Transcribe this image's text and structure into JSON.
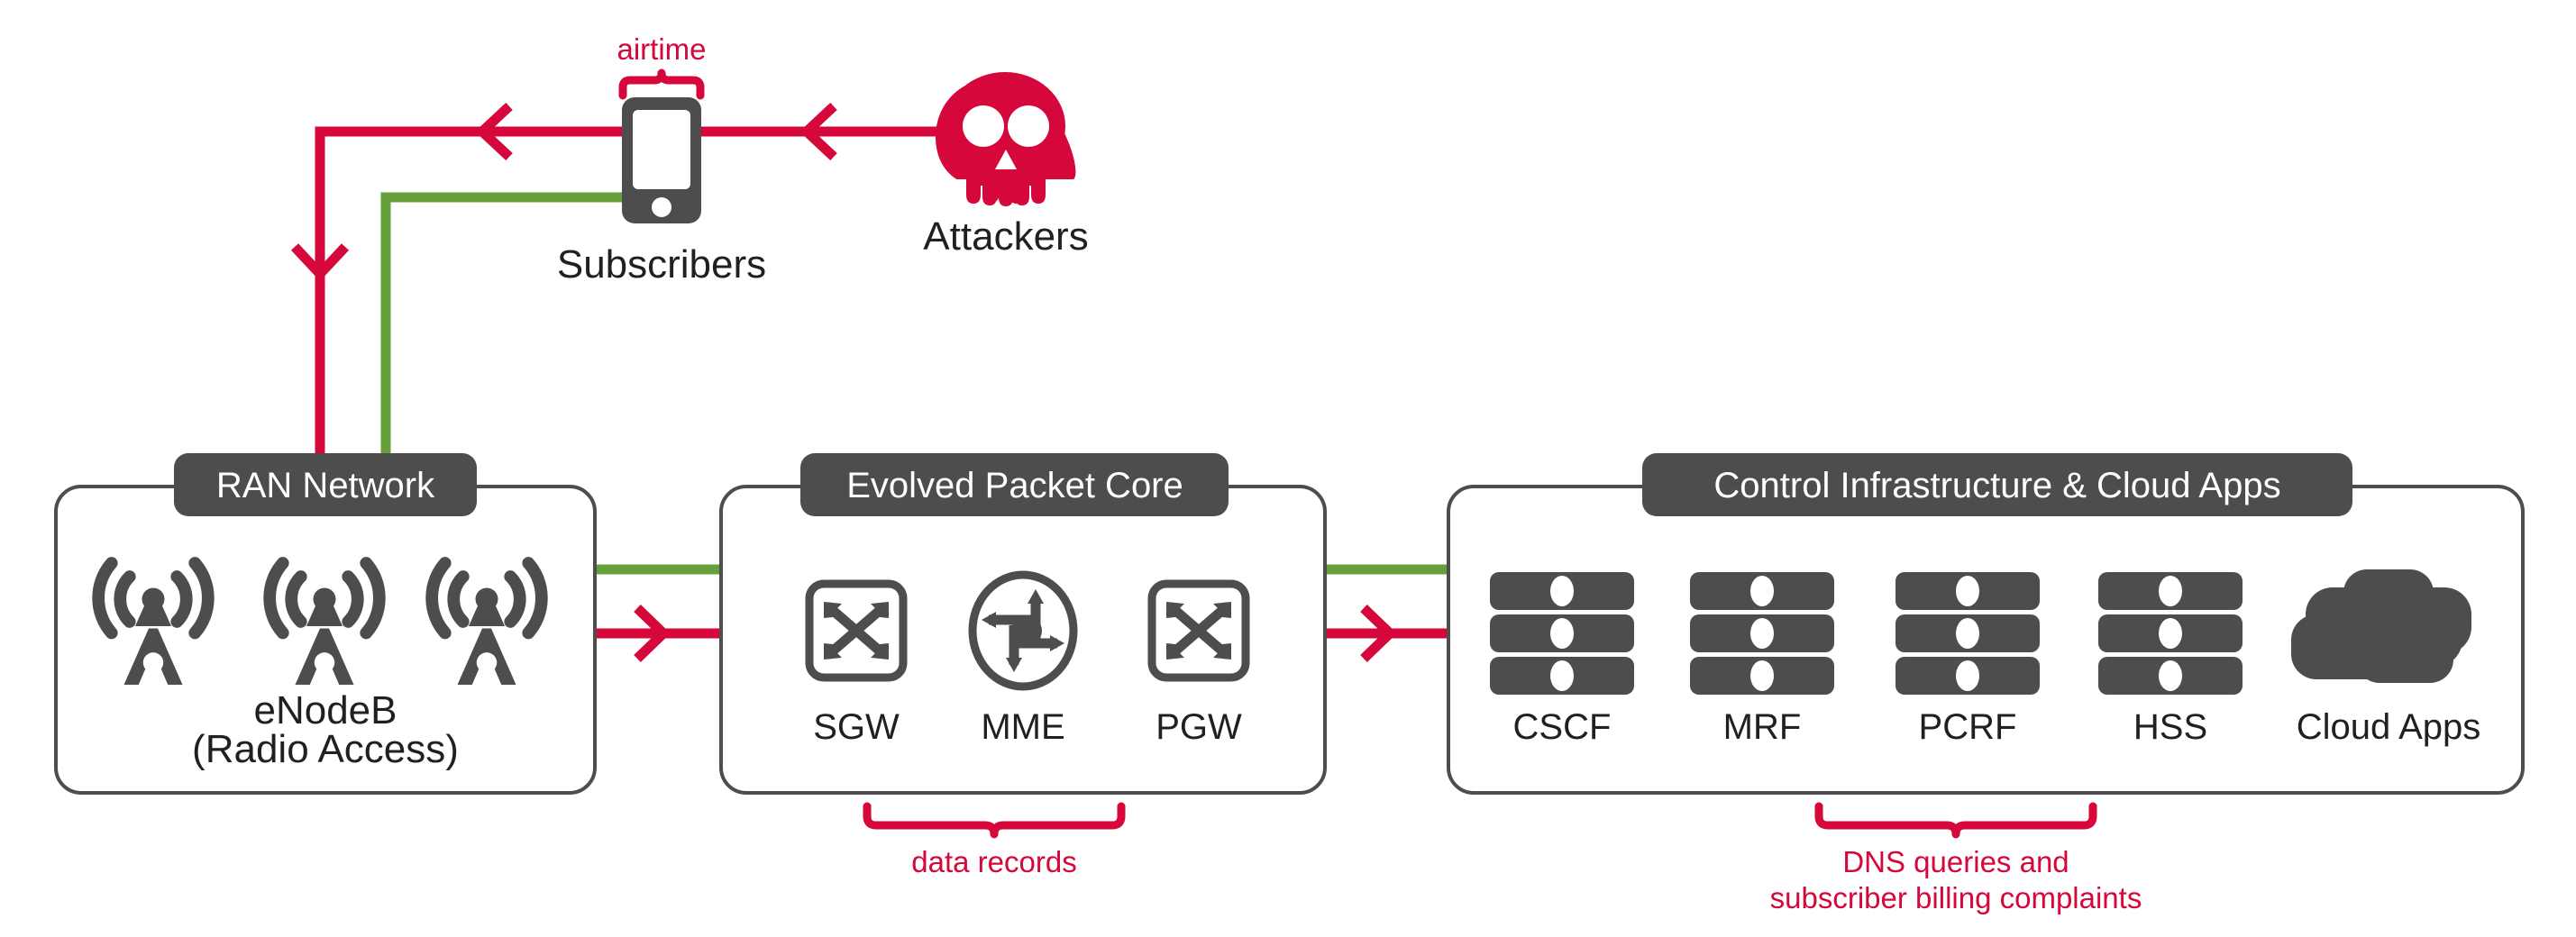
{
  "colors": {
    "red": "#d6073a",
    "green": "#66a03c",
    "dark": "#4d4d4d",
    "text": "#231f20",
    "white": "#ffffff"
  },
  "top": {
    "airtime_label": "airtime",
    "subscribers_label": "Subscribers",
    "attackers_label": "Attackers",
    "phone_icon": "mobile-phone-icon",
    "skull_icon": "skull-icon",
    "airtime_brace_icon": "curly-brace-up-icon"
  },
  "zones": [
    {
      "id": "ran",
      "title": "RAN Network",
      "caption_line1": "eNodeB",
      "caption_line2": "(Radio Access)",
      "nodes": [
        {
          "label": "",
          "icon": "cell-tower-icon"
        },
        {
          "label": "",
          "icon": "cell-tower-icon"
        },
        {
          "label": "",
          "icon": "cell-tower-icon"
        }
      ]
    },
    {
      "id": "epc",
      "title": "Evolved Packet Core",
      "nodes": [
        {
          "label": "SGW",
          "icon": "network-switch-icon"
        },
        {
          "label": "MME",
          "icon": "network-router-icon"
        },
        {
          "label": "PGW",
          "icon": "network-switch-icon"
        }
      ]
    },
    {
      "id": "control",
      "title": "Control Infrastructure & Cloud Apps",
      "nodes": [
        {
          "label": "CSCF",
          "icon": "server-rack-icon"
        },
        {
          "label": "MRF",
          "icon": "server-rack-icon"
        },
        {
          "label": "PCRF",
          "icon": "server-rack-icon"
        },
        {
          "label": "HSS",
          "icon": "server-rack-icon"
        },
        {
          "label": "Cloud Apps",
          "icon": "cloud-icon"
        }
      ]
    }
  ],
  "annotations": [
    {
      "id": "data-records",
      "lines": [
        "data records"
      ],
      "brace_icon": "curly-brace-down-icon"
    },
    {
      "id": "dns-billing",
      "lines": [
        "DNS queries and",
        "subscriber billing complaints"
      ],
      "brace_icon": "curly-brace-down-icon"
    }
  ],
  "flows": [
    {
      "id": "attack-path",
      "color": "#d6073a",
      "name": "attack-traffic-path"
    },
    {
      "id": "subscriber-path",
      "color": "#66a03c",
      "name": "subscriber-traffic-path"
    }
  ]
}
